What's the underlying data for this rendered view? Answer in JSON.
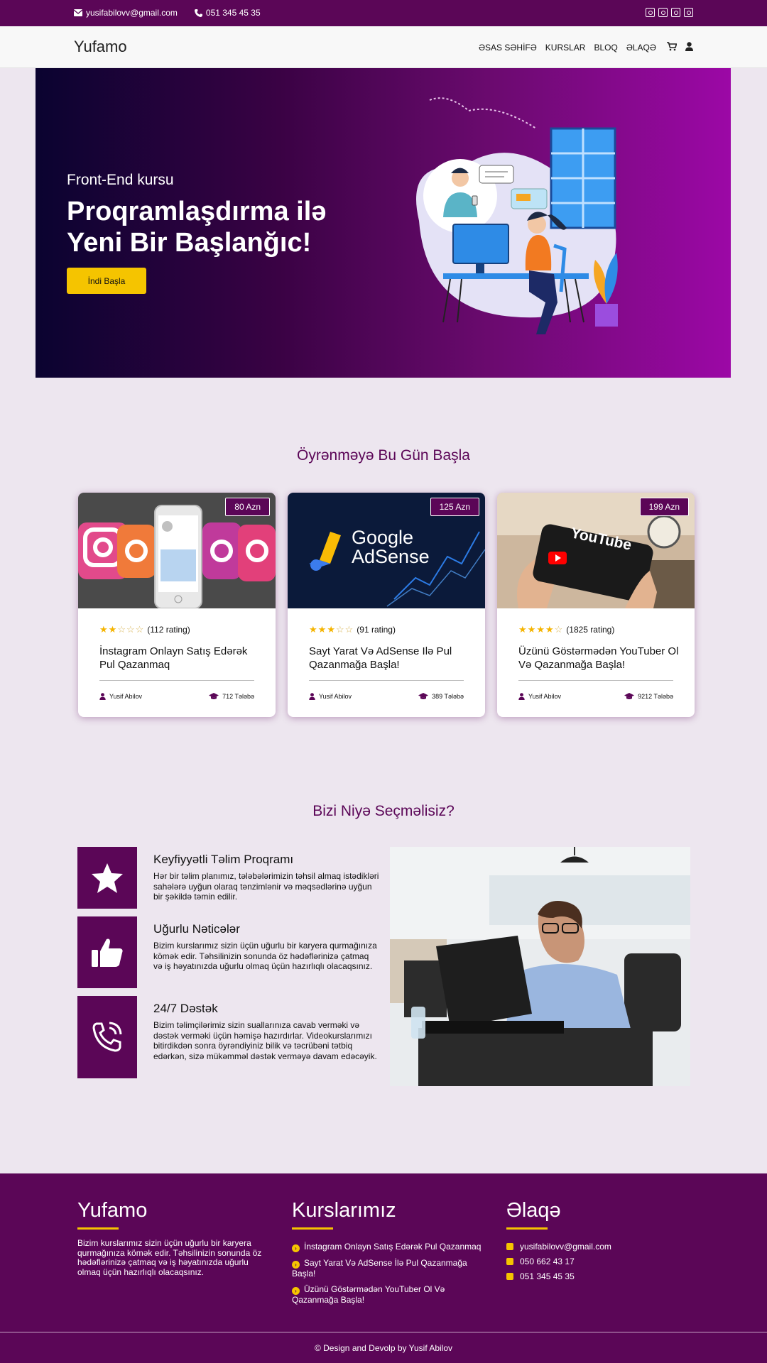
{
  "topbar": {
    "email": "yusifabilovv@gmail.com",
    "phone": "051 345 45 35",
    "socials": [
      "instagram-icon",
      "youtube-icon",
      "linkedin-icon",
      "github-icon"
    ]
  },
  "nav": {
    "brand": "Yufamo",
    "items": [
      "ƏSAS SƏHİFƏ",
      "KURSLAR",
      "BLOQ",
      "ƏLAQƏ"
    ]
  },
  "hero": {
    "subtitle": "Front-End kursu",
    "title": "Proqramlaşdırma ilə Yeni Bir Başlanğıc!",
    "button": "İndi Başla"
  },
  "courses": {
    "title": "Öyrənməyə Bu Gün Başla",
    "items": [
      {
        "price": "80 Azn",
        "stars": 2,
        "rating": "(112 rating)",
        "title": "İnstagram Onlayn Satış Edərək Pul Qazanmaq",
        "author": "Yusif Abilov",
        "students": "712 Tələbə"
      },
      {
        "price": "125 Azn",
        "stars": 3,
        "rating": "(91 rating)",
        "title": "Sayt Yarat Və AdSense Ilə Pul Qazanmağa Başla!",
        "author": "Yusif Abilov",
        "students": "389 Tələbə",
        "image_text": [
          "Google",
          "AdSense"
        ]
      },
      {
        "price": "199 Azn",
        "stars": 4,
        "rating": "(1825 rating)",
        "title": "Üzünü Göstərmədən YouTuber Ol Və Qazanmağa Başla!",
        "author": "Yusif Abilov",
        "students": "9212 Tələbə",
        "image_text": "YouTube"
      }
    ]
  },
  "why": {
    "title": "Bizi Niyə Seçməlisiz?",
    "features": [
      {
        "icon": "star-icon",
        "title": "Keyfiyyətli Təlim Proqramı",
        "text": "Hər bir təlim planımız, tələbələrimizin təhsil almaq istədikləri sahələrə uyğun olaraq tənzimlənir və məqsədlərinə uyğun bir şəkildə təmin edilir."
      },
      {
        "icon": "thumbs-up-icon",
        "title": "Uğurlu Nəticələr",
        "text": "Bizim kurslarımız sizin üçün uğurlu bir karyera qurmağınıza kömək edir. Təhsilinizin sonunda öz hədəflərinizə çatmaq və iş həyatınızda uğurlu olmaq üçün hazırlıqlı olacaqsınız."
      },
      {
        "icon": "phone-volume-icon",
        "title": "24/7 Dəstək",
        "text": "Bizim təlimçilərimiz sizin suallarınıza cavab verməki və dəstək verməki üçün həmişə hazırdırlar. Videokurslarımızı bitirdikdən sonra öyrəndiyiniz bilik və təcrübəni tətbiq edərkən, sizə mükəmməl dəstək verməyə davam edəcəyik."
      }
    ]
  },
  "footer": {
    "brand": "Yufamo",
    "about": "Bizim kurslarımız sizin üçün uğurlu bir karyera qurmağınıza kömək edir. Təhsilinizin sonunda öz hədəflərinizə çatmaq və iş həyatınızda uğurlu olmaq üçün hazırlıqlı olacaqsınız.",
    "courses_title": "Kurslarımız",
    "course_links": [
      "İnstagram Onlayn Satış Edərək Pul Qazanmaq",
      "Sayt Yarat Və AdSense İlə Pul Qazanmağa Başla!",
      "Üzünü Göstərmədən YouTuber Ol Və Qazanmağa Başla!"
    ],
    "contact_title": "Əlaqə",
    "email": "yusifabilovv@gmail.com",
    "phone1": "050 662 43 17",
    "phone2": "051 345 45 35",
    "copyright": "© Design and Devolp by Yusif Abilov"
  },
  "colors": {
    "brand_purple": "#5b0657",
    "accent_yellow": "#f5c400",
    "background": "#ede6ef"
  }
}
